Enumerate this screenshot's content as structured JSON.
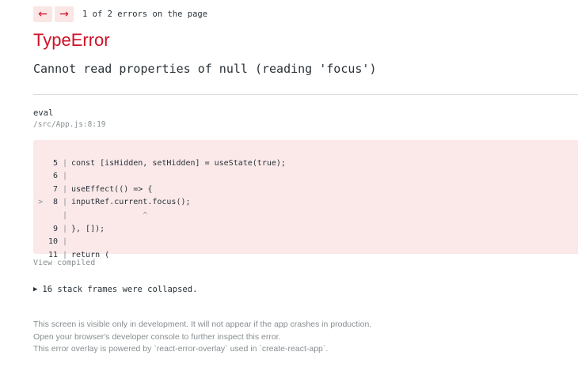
{
  "nav": {
    "prev_symbol": "←",
    "next_symbol": "→",
    "counter": "1 of 2 errors on the page"
  },
  "error": {
    "type": "TypeError",
    "message": "Cannot read properties of null (reading 'focus')"
  },
  "frame": {
    "function": "eval",
    "location": "/src/App.js:8:19"
  },
  "code": {
    "lines": [
      {
        "arrow": "",
        "num": "5",
        "bar": "|",
        "text": "const [isHidden, setHidden] = useState(true);"
      },
      {
        "arrow": "",
        "num": "6",
        "bar": "|",
        "text": ""
      },
      {
        "arrow": "",
        "num": "7",
        "bar": "|",
        "text": "useEffect(() => {"
      },
      {
        "arrow": ">",
        "num": "8",
        "bar": "|",
        "text": "inputRef.current.focus();"
      },
      {
        "arrow": "",
        "num": "",
        "bar": "|",
        "text": "               ^"
      },
      {
        "arrow": "",
        "num": "9",
        "bar": "|",
        "text": "}, []);"
      },
      {
        "arrow": "",
        "num": "10",
        "bar": "|",
        "text": ""
      },
      {
        "arrow": "",
        "num": "11",
        "bar": "|",
        "text": "return ("
      }
    ]
  },
  "view_compiled": "View compiled",
  "collapsed": {
    "icon": "▶",
    "text": "16 stack frames were collapsed."
  },
  "footer": {
    "line1": "This screen is visible only in development. It will not appear if the app crashes in production.",
    "line2": "Open your browser's developer console to further inspect this error.",
    "line3": "This error overlay is powered by `react-error-overlay` used in `create-react-app`."
  },
  "colors": {
    "error_red": "#ce1126",
    "code_bg": "#fbe9ea",
    "muted": "#878e91",
    "text": "#293238"
  }
}
